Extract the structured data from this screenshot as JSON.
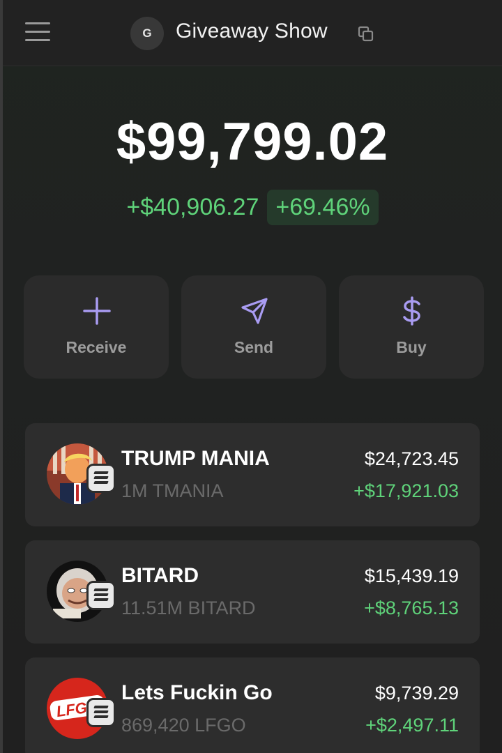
{
  "header": {
    "avatar_letter": "G",
    "account_name": "Giveaway Show"
  },
  "balance": {
    "total": "$99,799.02",
    "change_abs": "+$40,906.27",
    "change_pct": "+69.46%"
  },
  "actions": [
    {
      "label": "Receive",
      "icon": "plus-icon"
    },
    {
      "label": "Send",
      "icon": "send-icon"
    },
    {
      "label": "Buy",
      "icon": "dollar-icon"
    }
  ],
  "tokens": [
    {
      "name": "TRUMP MANIA",
      "quantity": "1M TMANIA",
      "value": "$24,723.45",
      "pnl": "+$17,921.03",
      "logo": "trump-mania-logo",
      "chain": "solana-icon"
    },
    {
      "name": "BITARD",
      "quantity": "11.51M BITARD",
      "value": "$15,439.19",
      "pnl": "+$8,765.13",
      "logo": "bitard-logo",
      "chain": "solana-icon"
    },
    {
      "name": "Lets Fuckin Go",
      "quantity": "869,420 LFGO",
      "value": "$9,739.29",
      "pnl": "+$2,497.11",
      "logo": "lfgo-logo",
      "logo_text": "LFGO",
      "chain": "solana-icon"
    }
  ],
  "colors": {
    "accent": "#a99cf2",
    "positive": "#5fd37a",
    "card": "#2d2d2d"
  }
}
